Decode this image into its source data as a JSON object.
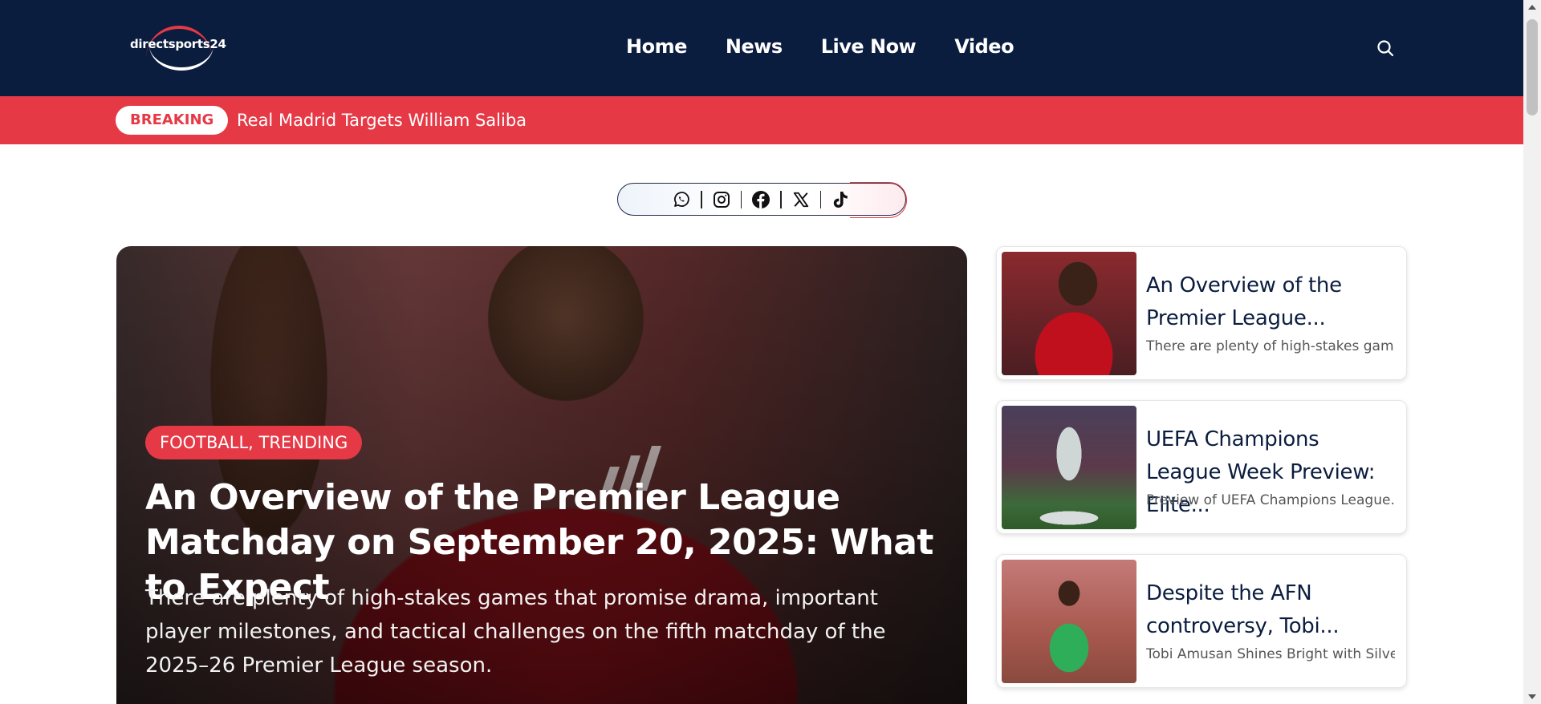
{
  "brand": {
    "logo_text": "directsports24"
  },
  "nav": {
    "items": [
      {
        "label": "Home"
      },
      {
        "label": "News"
      },
      {
        "label": "Live Now"
      },
      {
        "label": "Video"
      }
    ]
  },
  "breaking": {
    "badge": "BREAKING",
    "headline": "Real Madrid Targets William Saliba"
  },
  "social": {
    "icons": [
      "whatsapp-icon",
      "instagram-icon",
      "facebook-icon",
      "x-icon",
      "tiktok-icon"
    ]
  },
  "hero": {
    "tag": "FOOTBALL, TRENDING",
    "title": "An Overview of the Premier League Matchday on September 20, 2025: What to Expect",
    "excerpt": "There are plenty of high-stakes games that promise drama, important player milestones, and tactical challenges on the fifth matchday of the 2025–26 Premier League season."
  },
  "side_cards": [
    {
      "title": "An Overview of the Premier League...",
      "excerpt": "There are plenty of high-stakes gam..."
    },
    {
      "title": "UEFA Champions League Week Preview: Elite...",
      "excerpt": "Preview of UEFA Champions League..."
    },
    {
      "title": "Despite the AFN controversy, Tobi...",
      "excerpt": "Tobi Amusan Shines Bright with Silve..."
    }
  ],
  "colors": {
    "header_bg": "#0b1d3f",
    "accent": "#e63946",
    "text_dark": "#0b1d3f"
  }
}
